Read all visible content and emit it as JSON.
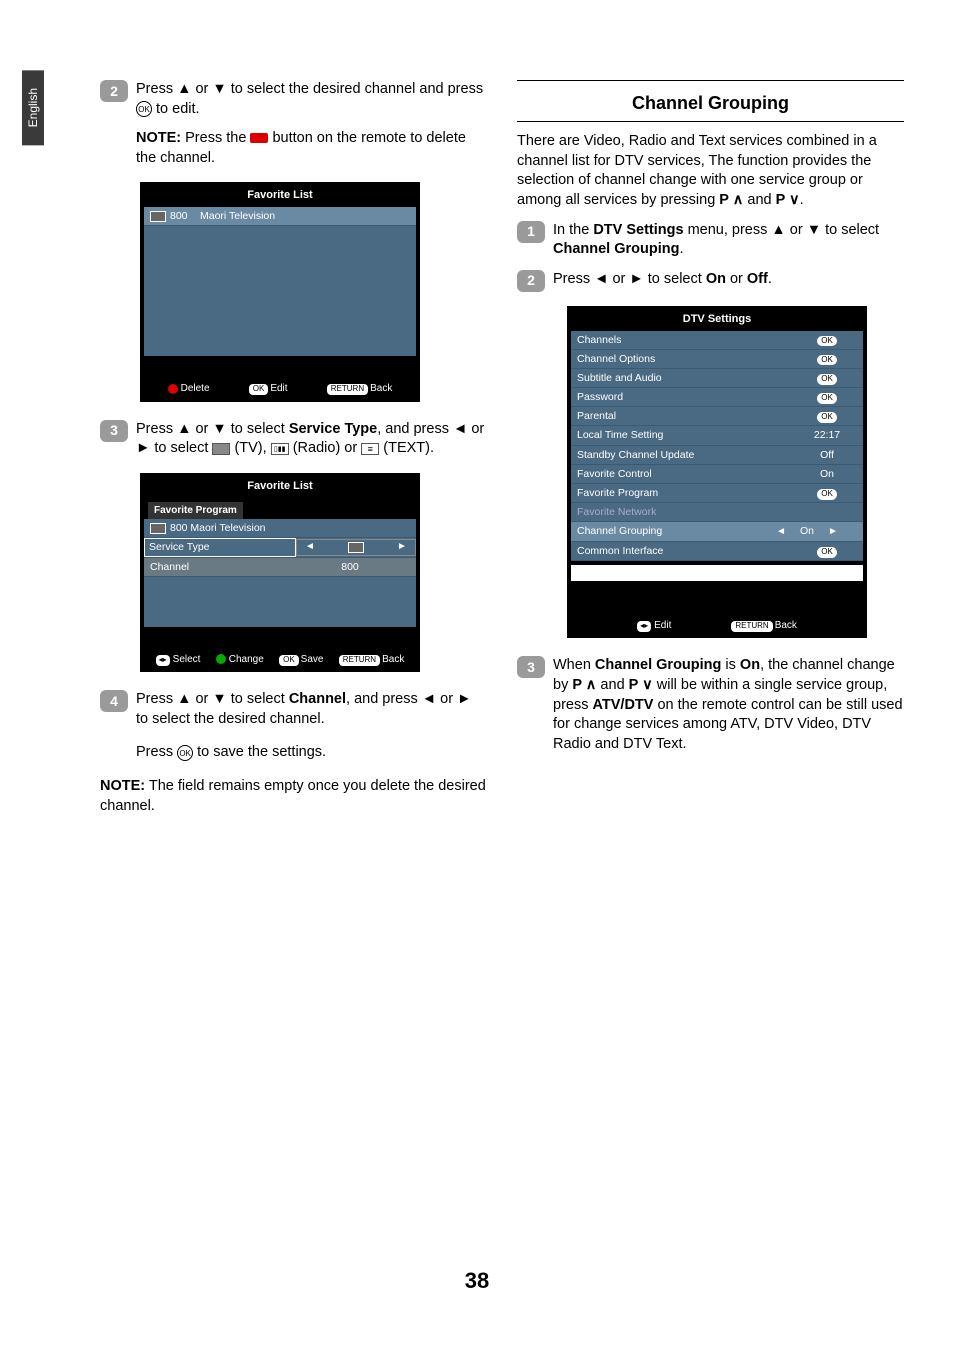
{
  "lang_tab": "English",
  "page_number": "38",
  "left": {
    "step2": {
      "num": "2",
      "text_pre": "Press ▲ or ▼ to select the desired channel and press ",
      "ok_icon": "OK",
      "text_post": " to edit."
    },
    "note1_label": "NOTE:",
    "note1_pre": " Press the ",
    "note1_post": " button on the remote to delete the channel.",
    "osd1": {
      "title": "Favorite List",
      "row_num": "800",
      "row_name": "Maori Television",
      "footer_delete": "Delete",
      "footer_edit_key": "OK",
      "footer_edit": "Edit",
      "footer_back_key": "RETURN",
      "footer_back": "Back"
    },
    "step3": {
      "num": "3",
      "line1_pre": "Press ▲ or ▼ to select ",
      "line1_bold": "Service Type",
      "line1_post": ", and press ◄ or ► to select ",
      "tv_label": " (TV), ",
      "radio_label": " (Radio) or ",
      "text_label": " (TEXT)."
    },
    "osd2": {
      "title": "Favorite List",
      "subheader": "Favorite Program",
      "row_800": "800 Maori Television",
      "service_type": "Service Type",
      "channel_label": "Channel",
      "channel_val": "800",
      "footer_select": "Select",
      "footer_change": "Change",
      "footer_save_key": "OK",
      "footer_save": "Save",
      "footer_back_key": "RETURN",
      "footer_back": "Back"
    },
    "step4": {
      "num": "4",
      "line_pre": "Press ▲ or ▼ to select ",
      "line_bold": "Channel",
      "line_post": ", and press ◄ or ► to select the desired channel."
    },
    "press_ok_pre": "Press ",
    "press_ok_post": " to save the settings.",
    "note2_label": "NOTE:",
    "note2_text": " The field remains empty once you delete the desired channel."
  },
  "right": {
    "title": "Channel Grouping",
    "intro_pre": "There are Video, Radio and Text services combined in a channel list for DTV services, The function provides the selection of channel change with one service group or among all services by pressing ",
    "p_up": "P ∧",
    "and": " and ",
    "p_down": "P ∨",
    "intro_post": ".",
    "step1": {
      "num": "1",
      "pre": "In the ",
      "bold1": "DTV Settings",
      "mid": " menu, press ▲ or ▼ to select ",
      "bold2": "Channel Grouping",
      "post": "."
    },
    "step2": {
      "num": "2",
      "pre": "Press ◄ or ► to select ",
      "on": "On",
      "or": " or ",
      "off": "Off",
      "post": "."
    },
    "osd": {
      "title": "DTV Settings",
      "rows": [
        {
          "label": "Channels",
          "val": "OK",
          "badge": true
        },
        {
          "label": "Channel Options",
          "val": "OK",
          "badge": true
        },
        {
          "label": "Subtitle and Audio",
          "val": "OK",
          "badge": true
        },
        {
          "label": "Password",
          "val": "OK",
          "badge": true
        },
        {
          "label": "Parental",
          "val": "OK",
          "badge": true
        },
        {
          "label": "Local Time Setting",
          "val": "22:17"
        },
        {
          "label": "Standby Channel Update",
          "val": "Off"
        },
        {
          "label": "Favorite Control",
          "val": "On"
        },
        {
          "label": "Favorite Program",
          "val": "OK",
          "badge": true
        },
        {
          "label": "Favorite Network",
          "val": "",
          "disabled": true
        },
        {
          "label": "Channel Grouping",
          "val": "On",
          "selected": true,
          "arrows": true
        },
        {
          "label": "Common Interface",
          "val": "OK",
          "badge": true
        }
      ],
      "footer_edit": "Edit",
      "footer_back_key": "RETURN",
      "footer_back": "Back"
    },
    "step3": {
      "num": "3",
      "pre": "When ",
      "bold1": "Channel Grouping",
      "mid1": " is ",
      "bold2": "On",
      "mid2": ", the channel change by ",
      "pup": "P ∧",
      "mid3": " and ",
      "pdown": "P ∨",
      "mid4": " will be within a single service group, press ",
      "bold3": "ATV/DTV",
      "post": " on the remote control can be still used for change services among ATV, DTV Video, DTV Radio and DTV Text."
    }
  }
}
